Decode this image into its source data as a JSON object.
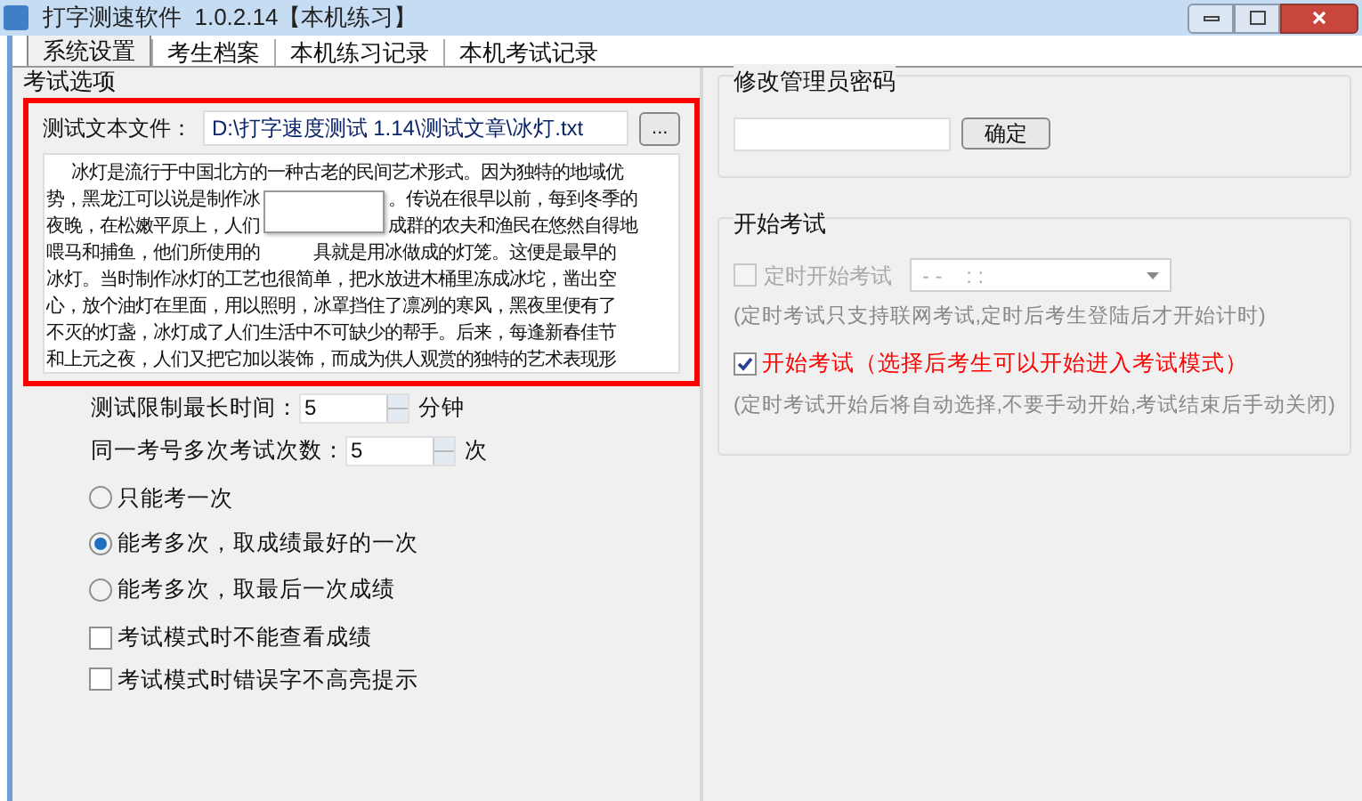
{
  "window": {
    "title": "打字测速软件  1.0.2.14【本机练习】"
  },
  "tabs": [
    {
      "label": "系统设置",
      "selected": true
    },
    {
      "label": "考生档案",
      "selected": false
    },
    {
      "label": "本机练习记录",
      "selected": false
    },
    {
      "label": "本机考试记录",
      "selected": false
    }
  ],
  "exam_options": {
    "title": "考试选项",
    "file_label": "测试文本文件：",
    "file_value": "D:\\打字速度测试 1.14\\测试文章\\冰灯.txt",
    "browse_button": "...",
    "text_lines": [
      [
        "冰灯是流行于中国北方的一种古老的民间艺术形式。因为独特的地域优"
      ],
      [
        "势，黑龙江可以说是制作冰",
        "。传说在很早以前，每到冬季的"
      ],
      [
        "夜晚，在松嫩平原上，人们",
        "成群的农夫和渔民在悠然自得地"
      ],
      [
        "喂马和捕鱼，他们所使用的",
        "具就是用冰做成的灯笼。这便是最早的"
      ],
      [
        "冰灯。当时制作冰灯的工艺也很简单，把水放进木桶里冻成冰坨，凿出空"
      ],
      [
        "心，放个油灯在里面，用以照明，冰罩挡住了凛冽的寒风，黑夜里便有了"
      ],
      [
        "不灭的灯盏，冰灯成了人们生活中不可缺少的帮手。后来，每逢新春佳节"
      ],
      [
        "和上元之夜，人们又把它加以装饰，而成为供人观赏的独特的艺术表现形"
      ]
    ],
    "spinners": [
      {
        "label": "测试限制最长时间：",
        "value": "5",
        "unit": "分钟"
      },
      {
        "label": "同一考号多次考试次数：",
        "value": "5",
        "unit": "次"
      }
    ],
    "radios": [
      {
        "label": "只能考一次",
        "selected": false
      },
      {
        "label": "能考多次，取成绩最好的一次",
        "selected": true
      },
      {
        "label": "能考多次，取最后一次成绩",
        "selected": false
      }
    ],
    "checkboxes": [
      {
        "label": "考试模式时不能查看成绩",
        "checked": false
      },
      {
        "label": "考试模式时错误字不高亮提示",
        "checked": false
      }
    ]
  },
  "admin_password": {
    "title": "修改管理员密码",
    "button": "确定"
  },
  "start_exam": {
    "title": "开始考试",
    "timed": {
      "label": "定时开始考试",
      "checked": false,
      "disabled": true,
      "value": "- -    : :"
    },
    "timed_note": "(定时考试只支持联网考试,定时后考生登陆后才开始计时)",
    "start": {
      "label": "开始考试（选择后考生可以开始进入考试模式）",
      "checked": true
    },
    "start_note": "(定时考试开始后将自动选择,不要手动开始,考试结束后手动关闭)"
  }
}
